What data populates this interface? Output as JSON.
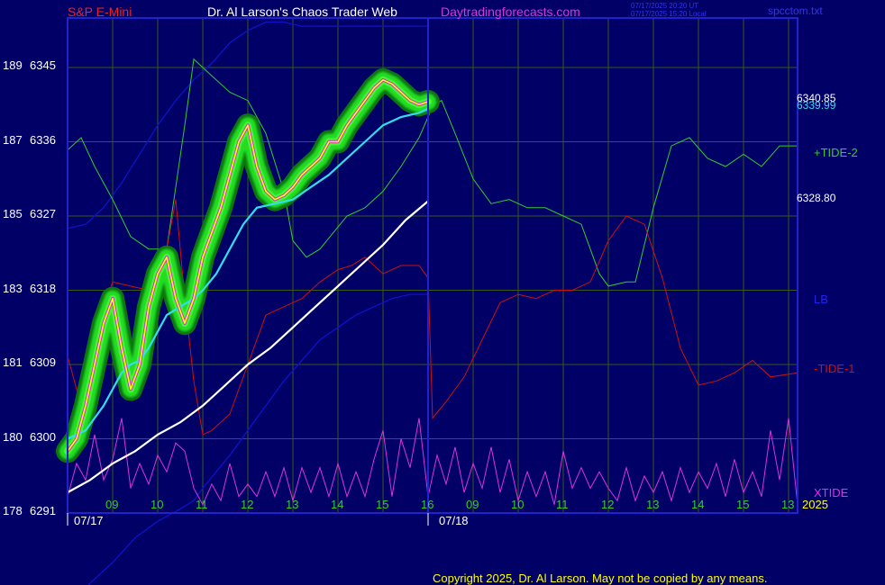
{
  "header": {
    "symbol": "S&P E-Mini",
    "author": "Dr. Al Larson's Chaos Trader Web",
    "site": "Daytradingforecasts.com",
    "time_ut": "07/17/2025 20:20 UT",
    "time_local": "07/17/2025 15:20 Local",
    "file": "spcctom.txt"
  },
  "footer": {
    "copyright": "Copyright 2025, Dr. Al Larson. May not be copied by any means."
  },
  "colors": {
    "background": "#000066",
    "grid": "#3a5a1a",
    "frame": "#2222cc",
    "price": "#ffff00",
    "glow": "#22dd22",
    "ema_fast": "#33ddee",
    "ema_slow": "#ffffff",
    "tide_plus": "#33cc33",
    "tide_minus": "#cc1111",
    "bands": "#1111cc",
    "xtide": "#dd33dd"
  },
  "chart_data": {
    "type": "line",
    "title": "S&P E-Mini",
    "ylim": [
      6291,
      6351
    ],
    "y_ticks": [
      {
        "left": "178",
        "price": 6291
      },
      {
        "left": "180",
        "price": 6300
      },
      {
        "left": "181",
        "price": 6309
      },
      {
        "left": "183",
        "price": 6318
      },
      {
        "left": "185",
        "price": 6327
      },
      {
        "left": "187",
        "price": 6336
      },
      {
        "left": "189",
        "price": 6345
      }
    ],
    "x_ticks": [
      "09",
      "10",
      "11",
      "12",
      "13",
      "14",
      "15",
      "16",
      "09",
      "10",
      "11",
      "12",
      "13",
      "14",
      "15",
      "13"
    ],
    "x_tick_positions": [
      9,
      10,
      11,
      12,
      13,
      14,
      15,
      16,
      17,
      18,
      19,
      20,
      21,
      22,
      23,
      24
    ],
    "date_labels": [
      {
        "text": "07/17",
        "x": 8.5
      },
      {
        "text": "07/18",
        "x": 16.6
      }
    ],
    "year_label": "2025",
    "xlim": [
      8.0,
      24.2
    ],
    "now_x": 16.0,
    "value_labels": [
      {
        "text": "6340.85",
        "price": 6340.85,
        "color": "#ffffff"
      },
      {
        "text": "6339.99",
        "price": 6339.99,
        "color": "#33ddee"
      },
      {
        "text": "6328.80",
        "price": 6328.8,
        "color": "#ffffff"
      }
    ],
    "series_labels": [
      {
        "text": "+TIDE-2",
        "color": "#33cc33",
        "y": 170
      },
      {
        "text": "LB",
        "color": "#2222ee",
        "y": 333
      },
      {
        "text": "-TIDE-1",
        "color": "#cc1111",
        "y": 410
      },
      {
        "text": "XTIDE",
        "color": "#dd33dd",
        "y": 548
      }
    ],
    "series": [
      {
        "name": "price",
        "x": [
          8.0,
          8.2,
          8.4,
          8.6,
          8.8,
          9.0,
          9.2,
          9.4,
          9.6,
          9.8,
          10.0,
          10.2,
          10.4,
          10.6,
          10.8,
          11.0,
          11.2,
          11.4,
          11.6,
          11.8,
          12.0,
          12.2,
          12.4,
          12.6,
          12.8,
          13.0,
          13.2,
          13.4,
          13.6,
          13.8,
          14.0,
          14.2,
          14.4,
          14.6,
          14.8,
          15.0,
          15.2,
          15.4,
          15.6,
          15.8,
          16.0
        ],
        "y": [
          6298.5,
          6300.0,
          6304.0,
          6309.0,
          6314.0,
          6317.0,
          6311.0,
          6306.0,
          6309.0,
          6316.0,
          6320.0,
          6322.0,
          6317.0,
          6314.0,
          6317.0,
          6322.0,
          6325.0,
          6328.0,
          6332.0,
          6336.0,
          6338.0,
          6333.0,
          6330.0,
          6329.0,
          6329.5,
          6330.5,
          6332.0,
          6333.0,
          6334.0,
          6336.0,
          6336.0,
          6338.0,
          6339.5,
          6341.0,
          6342.5,
          6343.5,
          6343.0,
          6342.0,
          6341.0,
          6340.5,
          6340.85
        ]
      },
      {
        "name": "ema_fast",
        "x": [
          8.0,
          8.4,
          8.8,
          9.2,
          9.4,
          9.6,
          9.8,
          10.0,
          10.2,
          10.5,
          10.8,
          11.0,
          11.3,
          11.6,
          11.9,
          12.2,
          12.6,
          13.0,
          13.4,
          13.8,
          14.2,
          14.6,
          15.0,
          15.4,
          15.8,
          16.0
        ],
        "y": [
          6300.0,
          6301.0,
          6304.0,
          6308.0,
          6309.0,
          6309.5,
          6311.0,
          6313.0,
          6315.0,
          6316.0,
          6317.0,
          6318.0,
          6320.0,
          6323.0,
          6326.0,
          6328.0,
          6328.5,
          6329.0,
          6330.5,
          6332.0,
          6334.0,
          6336.0,
          6338.0,
          6339.0,
          6339.5,
          6339.99
        ]
      },
      {
        "name": "ema_slow",
        "x": [
          8.0,
          8.5,
          9.0,
          9.5,
          10.0,
          10.5,
          11.0,
          11.5,
          12.0,
          12.5,
          13.0,
          13.5,
          14.0,
          14.5,
          15.0,
          15.5,
          16.0
        ],
        "y": [
          6293.5,
          6295.0,
          6297.0,
          6298.5,
          6300.5,
          6302.0,
          6304.0,
          6306.5,
          6309.0,
          6311.0,
          6313.5,
          6316.0,
          6318.5,
          6321.0,
          6323.5,
          6326.5,
          6328.8
        ]
      },
      {
        "name": "+TIDE-2",
        "x": [
          8.0,
          8.3,
          8.6,
          9.0,
          9.4,
          9.8,
          10.2,
          10.6,
          10.8,
          11.0,
          11.2,
          11.6,
          12.0,
          12.4,
          12.8,
          13.0,
          13.3,
          13.6,
          13.9,
          14.2,
          14.6,
          15.0,
          15.4,
          15.8,
          16.0,
          16.1,
          16.3,
          16.6,
          17.0,
          17.4,
          17.8,
          18.2,
          18.6,
          19.0,
          19.4,
          19.8,
          20.0,
          20.4,
          20.6,
          21.0,
          21.4,
          21.8,
          22.2,
          22.6,
          23.0,
          23.4,
          23.8,
          24.2
        ],
        "y": [
          6335.0,
          6336.5,
          6333.0,
          6329.0,
          6324.5,
          6323.0,
          6323.0,
          6338.0,
          6346.0,
          6345.0,
          6344.0,
          6342.0,
          6341.0,
          6337.0,
          6330.0,
          6324.0,
          6322.0,
          6323.0,
          6325.0,
          6327.0,
          6328.0,
          6330.0,
          6333.0,
          6336.5,
          6339.0,
          6340.5,
          6341.0,
          6337.0,
          6331.5,
          6328.5,
          6329.0,
          6328.0,
          6328.0,
          6327.0,
          6326.0,
          6320.0,
          6318.5,
          6319.0,
          6319.0,
          6328.0,
          6335.5,
          6336.5,
          6334.0,
          6333.0,
          6334.5,
          6333.0,
          6335.5,
          6335.5
        ]
      },
      {
        "name": "-TIDE-1",
        "x": [
          8.0,
          8.3,
          8.6,
          9.0,
          9.4,
          9.8,
          10.2,
          10.4,
          10.6,
          10.8,
          11.0,
          11.2,
          11.6,
          12.0,
          12.4,
          12.8,
          13.2,
          13.6,
          14.0,
          14.3,
          14.6,
          15.0,
          15.4,
          15.8,
          16.0,
          16.1,
          16.4,
          16.8,
          17.2,
          17.6,
          18.0,
          18.4,
          18.8,
          19.2,
          19.6,
          20.0,
          20.4,
          20.8,
          21.2,
          21.6,
          22.0,
          22.4,
          22.8,
          23.2,
          23.6,
          24.2
        ],
        "y": [
          6310.0,
          6304.0,
          6313.0,
          6319.0,
          6318.5,
          6318.0,
          6323.0,
          6329.0,
          6317.0,
          6307.0,
          6300.5,
          6301.0,
          6303.0,
          6309.0,
          6315.0,
          6316.0,
          6317.0,
          6319.0,
          6320.5,
          6321.0,
          6322.0,
          6320.0,
          6321.0,
          6321.0,
          6319.5,
          6302.5,
          6304.5,
          6307.5,
          6312.0,
          6316.5,
          6317.5,
          6317.0,
          6318.0,
          6318.0,
          6319.0,
          6324.0,
          6327.0,
          6326.0,
          6319.5,
          6311.0,
          6306.5,
          6307.0,
          6308.0,
          6309.5,
          6307.5,
          6308.0
        ]
      },
      {
        "name": "upper_band",
        "x": [
          8.0,
          8.4,
          8.8,
          9.2,
          9.6,
          10.0,
          10.4,
          10.8,
          11.2,
          11.6,
          12.0,
          12.4,
          12.8,
          13.2,
          13.6,
          14.0,
          14.4,
          14.8,
          15.2,
          15.6,
          16.0
        ],
        "y": [
          6325.5,
          6326.0,
          6328.0,
          6331.0,
          6334.5,
          6338.0,
          6341.0,
          6343.5,
          6345.5,
          6348.0,
          6349.5,
          6350.5,
          6350.5,
          6350.0,
          6350.0,
          6350.0,
          6350.0,
          6350.0,
          6350.0,
          6350.0,
          6350.0
        ]
      },
      {
        "name": "lower_band",
        "x": [
          8.0,
          8.5,
          9.0,
          9.5,
          10.0,
          10.5,
          10.8,
          11.0,
          11.3,
          11.6,
          12.0,
          12.4,
          12.8,
          13.2,
          13.6,
          14.0,
          14.4,
          14.8,
          15.2,
          15.6,
          16.0
        ],
        "y": [
          6279.0,
          6282.5,
          6285.0,
          6288.0,
          6290.0,
          6291.5,
          6292.5,
          6294.0,
          6296.0,
          6298.0,
          6301.0,
          6304.0,
          6307.0,
          6309.5,
          6312.0,
          6313.5,
          6315.0,
          6316.0,
          6317.0,
          6317.5,
          6317.5
        ]
      },
      {
        "name": "XTIDE",
        "x": [
          8.0,
          8.2,
          8.4,
          8.6,
          8.8,
          9.0,
          9.2,
          9.4,
          9.6,
          9.8,
          10.0,
          10.2,
          10.4,
          10.6,
          10.8,
          11.0,
          11.2,
          11.4,
          11.6,
          11.8,
          12.0,
          12.2,
          12.4,
          12.6,
          12.8,
          13.0,
          13.2,
          13.4,
          13.6,
          13.8,
          14.0,
          14.2,
          14.4,
          14.6,
          14.8,
          15.0,
          15.2,
          15.4,
          15.6,
          15.8,
          16.0,
          16.2,
          16.4,
          16.6,
          16.8,
          17.0,
          17.2,
          17.4,
          17.6,
          17.8,
          18.0,
          18.2,
          18.4,
          18.6,
          18.8,
          19.0,
          19.2,
          19.4,
          19.6,
          19.8,
          20.0,
          20.2,
          20.4,
          20.6,
          20.8,
          21.0,
          21.2,
          21.4,
          21.6,
          21.8,
          22.0,
          22.2,
          22.4,
          22.6,
          22.8,
          23.0,
          23.2,
          23.4,
          23.6,
          23.8,
          24.0,
          24.2
        ],
        "y": [
          6293.0,
          6297.0,
          6295.0,
          6300.5,
          6295.0,
          6297.5,
          6302.5,
          6294.0,
          6297.0,
          6294.5,
          6298.0,
          6296.0,
          6299.5,
          6298.5,
          6294.0,
          6292.0,
          6294.5,
          6292.5,
          6297.0,
          6293.0,
          6294.5,
          6293.0,
          6296.0,
          6293.0,
          6296.5,
          6292.5,
          6296.5,
          6293.5,
          6296.5,
          6293.0,
          6297.0,
          6293.0,
          6296.0,
          6293.0,
          6297.5,
          6301.0,
          6293.0,
          6300.0,
          6296.5,
          6302.5,
          6293.0,
          6298.0,
          6294.5,
          6299.0,
          6293.5,
          6297.0,
          6294.0,
          6299.0,
          6293.5,
          6297.5,
          6292.5,
          6296.0,
          6293.0,
          6296.0,
          6292.0,
          6298.5,
          6294.0,
          6296.5,
          6294.0,
          6296.0,
          6294.0,
          6292.5,
          6296.5,
          6292.5,
          6295.5,
          6293.5,
          6296.0,
          6292.5,
          6296.5,
          6293.5,
          6296.0,
          6294.0,
          6297.0,
          6293.0,
          6297.5,
          6293.5,
          6296.0,
          6293.0,
          6301.0,
          6295.0,
          6302.5,
          6292.0
        ]
      }
    ]
  }
}
